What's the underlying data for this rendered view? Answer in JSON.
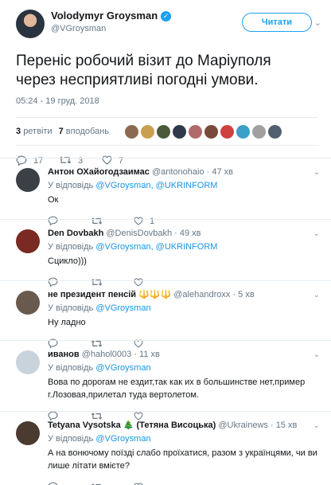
{
  "main_tweet": {
    "author_name": "Volodymyr Groysman",
    "verified_mark": "✓",
    "handle": "@VGroysman",
    "follow_label": "Читати",
    "text": "Переніс робочий візит до Маріуполя через несприятливі погодні умови.",
    "timestamp": "05:24 - 19 груд. 2018",
    "retweets_count": "3",
    "retweets_label": "ретвіти",
    "likes_count": "7",
    "likes_label": "вподобань",
    "replies": "17",
    "retweets": "3",
    "likes": "7",
    "liker_colors": [
      "#8a6b52",
      "#c8a050",
      "#4b5a3a",
      "#2e3a4a",
      "#b06a6a",
      "#7a4a3a",
      "#d04040",
      "#3aa0c8",
      "#a0a0a0",
      "#506070"
    ]
  },
  "icons": {
    "reply": "reply-icon",
    "retweet": "retweet-icon",
    "like": "heart-icon",
    "caret": "chevron-down-icon"
  },
  "replies": [
    {
      "name": "Антон ОХайогодзаимас",
      "handle": "@antonohaio",
      "time": "47 хв",
      "reply_prefix": "У відповідь",
      "reply_to": "@VGroysman, @UKRINFORM",
      "text": "Ок",
      "replies": "",
      "retweets": "",
      "likes": "1",
      "avatar_color": "#3b3f46"
    },
    {
      "name": "Den Dovbakh",
      "handle": "@DenisDovbakh",
      "time": "49 хв",
      "reply_prefix": "У відповідь",
      "reply_to": "@VGroysman, @UKRINFORM",
      "text": "Сцикло)))",
      "replies": "",
      "retweets": "",
      "likes": "",
      "avatar_color": "#7a2a22"
    },
    {
      "name": "не президент пенсій 🔱🔱🔱",
      "handle": "@alehandroxx",
      "time": "5 хв",
      "reply_prefix": "У відповідь",
      "reply_to": "@VGroysman",
      "text": "Ну ладно",
      "replies": "",
      "retweets": "",
      "likes": "",
      "avatar_color": "#6a5a4e"
    },
    {
      "name": "иванов",
      "handle": "@hahol0003",
      "time": "11 хв",
      "reply_prefix": "У відповідь",
      "reply_to": "@VGroysman",
      "text": "Вова по дорогам не ездит,так как их в большинстве нет,пример г.Лозовая,прилетал туда вертолетом.",
      "replies": "",
      "retweets": "",
      "likes": "",
      "avatar_color": "#c9d3dc"
    },
    {
      "name": "Tetyana Vysotska 🎄 (Тетяна Висоцька)",
      "handle": "@Ukrainews",
      "time": "15 хв",
      "reply_prefix": "У відповідь",
      "reply_to": "@VGroysman",
      "text": "А на вонючому поїзді слабо проїхатися, разом з українцями, чи ви лише літати вмієте?",
      "replies": "",
      "retweets": "",
      "likes": "",
      "avatar_color": "#4a3a30"
    }
  ]
}
